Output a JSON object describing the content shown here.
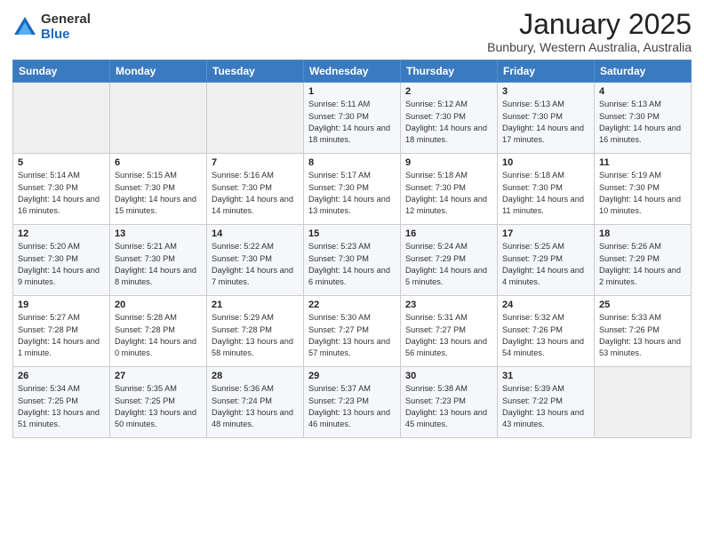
{
  "logo": {
    "general": "General",
    "blue": "Blue"
  },
  "header": {
    "title": "January 2025",
    "location": "Bunbury, Western Australia, Australia"
  },
  "days": [
    "Sunday",
    "Monday",
    "Tuesday",
    "Wednesday",
    "Thursday",
    "Friday",
    "Saturday"
  ],
  "weeks": [
    [
      {
        "day": "",
        "info": ""
      },
      {
        "day": "",
        "info": ""
      },
      {
        "day": "",
        "info": ""
      },
      {
        "day": "1",
        "info": "Sunrise: 5:11 AM\nSunset: 7:30 PM\nDaylight: 14 hours\nand 18 minutes."
      },
      {
        "day": "2",
        "info": "Sunrise: 5:12 AM\nSunset: 7:30 PM\nDaylight: 14 hours\nand 18 minutes."
      },
      {
        "day": "3",
        "info": "Sunrise: 5:13 AM\nSunset: 7:30 PM\nDaylight: 14 hours\nand 17 minutes."
      },
      {
        "day": "4",
        "info": "Sunrise: 5:13 AM\nSunset: 7:30 PM\nDaylight: 14 hours\nand 16 minutes."
      }
    ],
    [
      {
        "day": "5",
        "info": "Sunrise: 5:14 AM\nSunset: 7:30 PM\nDaylight: 14 hours\nand 16 minutes."
      },
      {
        "day": "6",
        "info": "Sunrise: 5:15 AM\nSunset: 7:30 PM\nDaylight: 14 hours\nand 15 minutes."
      },
      {
        "day": "7",
        "info": "Sunrise: 5:16 AM\nSunset: 7:30 PM\nDaylight: 14 hours\nand 14 minutes."
      },
      {
        "day": "8",
        "info": "Sunrise: 5:17 AM\nSunset: 7:30 PM\nDaylight: 14 hours\nand 13 minutes."
      },
      {
        "day": "9",
        "info": "Sunrise: 5:18 AM\nSunset: 7:30 PM\nDaylight: 14 hours\nand 12 minutes."
      },
      {
        "day": "10",
        "info": "Sunrise: 5:18 AM\nSunset: 7:30 PM\nDaylight: 14 hours\nand 11 minutes."
      },
      {
        "day": "11",
        "info": "Sunrise: 5:19 AM\nSunset: 7:30 PM\nDaylight: 14 hours\nand 10 minutes."
      }
    ],
    [
      {
        "day": "12",
        "info": "Sunrise: 5:20 AM\nSunset: 7:30 PM\nDaylight: 14 hours\nand 9 minutes."
      },
      {
        "day": "13",
        "info": "Sunrise: 5:21 AM\nSunset: 7:30 PM\nDaylight: 14 hours\nand 8 minutes."
      },
      {
        "day": "14",
        "info": "Sunrise: 5:22 AM\nSunset: 7:30 PM\nDaylight: 14 hours\nand 7 minutes."
      },
      {
        "day": "15",
        "info": "Sunrise: 5:23 AM\nSunset: 7:30 PM\nDaylight: 14 hours\nand 6 minutes."
      },
      {
        "day": "16",
        "info": "Sunrise: 5:24 AM\nSunset: 7:29 PM\nDaylight: 14 hours\nand 5 minutes."
      },
      {
        "day": "17",
        "info": "Sunrise: 5:25 AM\nSunset: 7:29 PM\nDaylight: 14 hours\nand 4 minutes."
      },
      {
        "day": "18",
        "info": "Sunrise: 5:26 AM\nSunset: 7:29 PM\nDaylight: 14 hours\nand 2 minutes."
      }
    ],
    [
      {
        "day": "19",
        "info": "Sunrise: 5:27 AM\nSunset: 7:28 PM\nDaylight: 14 hours\nand 1 minute."
      },
      {
        "day": "20",
        "info": "Sunrise: 5:28 AM\nSunset: 7:28 PM\nDaylight: 14 hours\nand 0 minutes."
      },
      {
        "day": "21",
        "info": "Sunrise: 5:29 AM\nSunset: 7:28 PM\nDaylight: 13 hours\nand 58 minutes."
      },
      {
        "day": "22",
        "info": "Sunrise: 5:30 AM\nSunset: 7:27 PM\nDaylight: 13 hours\nand 57 minutes."
      },
      {
        "day": "23",
        "info": "Sunrise: 5:31 AM\nSunset: 7:27 PM\nDaylight: 13 hours\nand 56 minutes."
      },
      {
        "day": "24",
        "info": "Sunrise: 5:32 AM\nSunset: 7:26 PM\nDaylight: 13 hours\nand 54 minutes."
      },
      {
        "day": "25",
        "info": "Sunrise: 5:33 AM\nSunset: 7:26 PM\nDaylight: 13 hours\nand 53 minutes."
      }
    ],
    [
      {
        "day": "26",
        "info": "Sunrise: 5:34 AM\nSunset: 7:25 PM\nDaylight: 13 hours\nand 51 minutes."
      },
      {
        "day": "27",
        "info": "Sunrise: 5:35 AM\nSunset: 7:25 PM\nDaylight: 13 hours\nand 50 minutes."
      },
      {
        "day": "28",
        "info": "Sunrise: 5:36 AM\nSunset: 7:24 PM\nDaylight: 13 hours\nand 48 minutes."
      },
      {
        "day": "29",
        "info": "Sunrise: 5:37 AM\nSunset: 7:23 PM\nDaylight: 13 hours\nand 46 minutes."
      },
      {
        "day": "30",
        "info": "Sunrise: 5:38 AM\nSunset: 7:23 PM\nDaylight: 13 hours\nand 45 minutes."
      },
      {
        "day": "31",
        "info": "Sunrise: 5:39 AM\nSunset: 7:22 PM\nDaylight: 13 hours\nand 43 minutes."
      },
      {
        "day": "",
        "info": ""
      }
    ]
  ]
}
